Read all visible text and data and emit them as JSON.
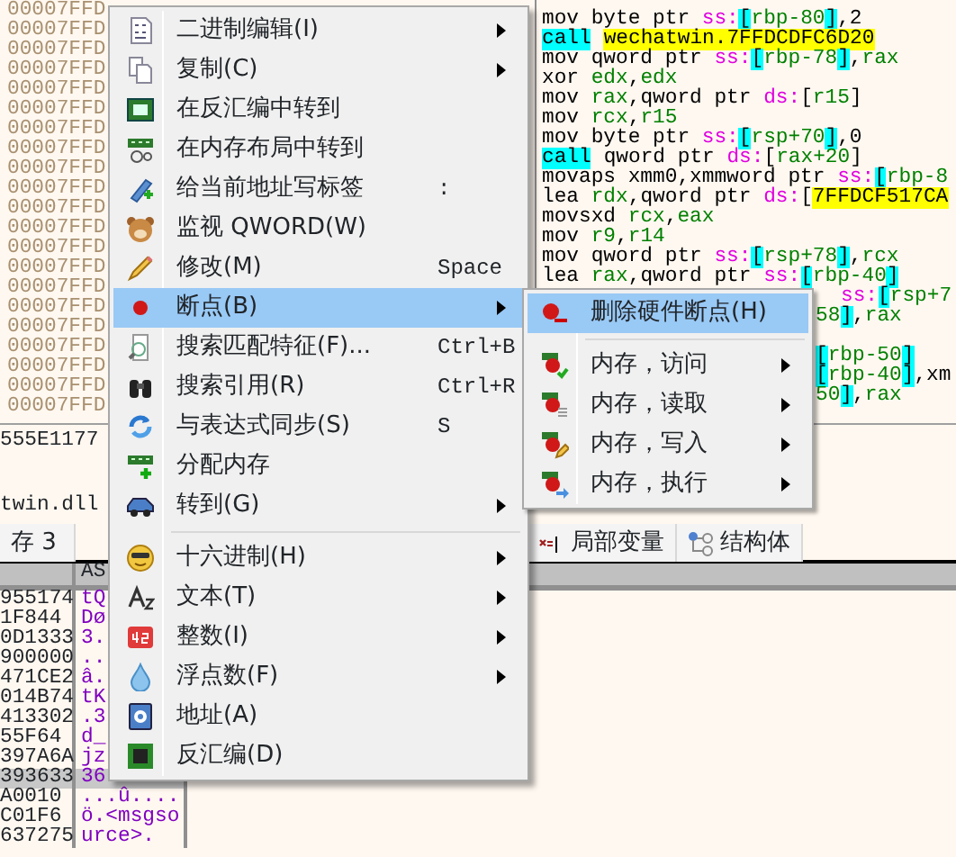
{
  "address_rows": [
    "00007FFD",
    "00007FFD",
    "00007FFD",
    "00007FFD",
    "00007FFD",
    "00007FFD",
    "00007FFD",
    "00007FFD",
    "00007FFD",
    "00007FFD",
    "00007FFD",
    "00007FFD",
    "00007FFD",
    "00007FFD",
    "00007FFD",
    "00007FFD",
    "00007FFD",
    "00007FFD",
    "00007FFD",
    "00007FFD",
    "00007FFD"
  ],
  "code_lines": [
    {
      "tokens": [
        {
          "kind": "plain",
          "text": "mov byte ptr "
        },
        {
          "kind": "segment",
          "text": "ss:"
        },
        {
          "kind": "bracket",
          "text": "["
        },
        {
          "kind": "register",
          "text": "rbp-80"
        },
        {
          "kind": "bracket",
          "text": "]"
        },
        {
          "kind": "plain",
          "text": ",2"
        }
      ]
    },
    {
      "tokens": [
        {
          "kind": "call",
          "text": "call"
        },
        {
          "kind": "address",
          "text": "wechatwin.7FFDCDFC6D20"
        }
      ]
    },
    {
      "tokens": [
        {
          "kind": "plain",
          "text": "mov qword ptr "
        },
        {
          "kind": "segment",
          "text": "ss:"
        },
        {
          "kind": "bracket",
          "text": "["
        },
        {
          "kind": "register",
          "text": "rbp-78"
        },
        {
          "kind": "bracket",
          "text": "]"
        },
        {
          "kind": "plain",
          "text": ","
        },
        {
          "kind": "register",
          "text": "rax"
        }
      ]
    },
    {
      "tokens": [
        {
          "kind": "plain",
          "text": "xor "
        },
        {
          "kind": "register",
          "text": "edx"
        },
        {
          "kind": "plain",
          "text": ","
        },
        {
          "kind": "register",
          "text": "edx"
        }
      ]
    },
    {
      "tokens": [
        {
          "kind": "plain",
          "text": "mov "
        },
        {
          "kind": "register",
          "text": "rax"
        },
        {
          "kind": "plain",
          "text": ",qword ptr "
        },
        {
          "kind": "segment",
          "text": "ds:"
        },
        {
          "kind": "plain",
          "text": "["
        },
        {
          "kind": "register",
          "text": "r15"
        },
        {
          "kind": "plain",
          "text": "]"
        }
      ]
    },
    {
      "tokens": [
        {
          "kind": "plain",
          "text": "mov "
        },
        {
          "kind": "register",
          "text": "rcx"
        },
        {
          "kind": "plain",
          "text": ","
        },
        {
          "kind": "register",
          "text": "r15"
        }
      ]
    },
    {
      "tokens": [
        {
          "kind": "plain",
          "text": "mov byte ptr "
        },
        {
          "kind": "segment",
          "text": "ss:"
        },
        {
          "kind": "bracket",
          "text": "["
        },
        {
          "kind": "register",
          "text": "rsp+70"
        },
        {
          "kind": "bracket",
          "text": "]"
        },
        {
          "kind": "plain",
          "text": ",0"
        }
      ]
    },
    {
      "tokens": [
        {
          "kind": "call",
          "text": "call"
        },
        {
          "kind": "plain",
          "text": "qword ptr "
        },
        {
          "kind": "segment",
          "text": "ds:"
        },
        {
          "kind": "plain",
          "text": "["
        },
        {
          "kind": "register",
          "text": "rax+20"
        },
        {
          "kind": "plain",
          "text": "]"
        }
      ]
    },
    {
      "tokens": [
        {
          "kind": "plain",
          "text": "movaps xmm0,xmmword ptr "
        },
        {
          "kind": "segment",
          "text": "ss:"
        },
        {
          "kind": "bracket",
          "text": "["
        },
        {
          "kind": "register",
          "text": "rbp-8"
        }
      ]
    },
    {
      "tokens": [
        {
          "kind": "plain",
          "text": "lea "
        },
        {
          "kind": "register",
          "text": "rdx"
        },
        {
          "kind": "plain",
          "text": ",qword ptr "
        },
        {
          "kind": "segment",
          "text": "ds:"
        },
        {
          "kind": "plain",
          "text": "["
        },
        {
          "kind": "address",
          "text": "7FFDCF517CA"
        }
      ]
    },
    {
      "tokens": [
        {
          "kind": "plain",
          "text": "movsxd "
        },
        {
          "kind": "register",
          "text": "rcx"
        },
        {
          "kind": "plain",
          "text": ","
        },
        {
          "kind": "register",
          "text": "eax"
        }
      ]
    },
    {
      "tokens": [
        {
          "kind": "plain",
          "text": "mov "
        },
        {
          "kind": "register",
          "text": "r9"
        },
        {
          "kind": "plain",
          "text": ","
        },
        {
          "kind": "register",
          "text": "r14"
        }
      ]
    },
    {
      "tokens": [
        {
          "kind": "plain",
          "text": "mov qword ptr "
        },
        {
          "kind": "segment",
          "text": "ss:"
        },
        {
          "kind": "bracket",
          "text": "["
        },
        {
          "kind": "register",
          "text": "rsp+78"
        },
        {
          "kind": "bracket",
          "text": "]"
        },
        {
          "kind": "plain",
          "text": ","
        },
        {
          "kind": "register",
          "text": "rcx"
        }
      ]
    },
    {
      "tokens": [
        {
          "kind": "plain",
          "text": "lea "
        },
        {
          "kind": "register",
          "text": "rax"
        },
        {
          "kind": "plain",
          "text": ",qword ptr "
        },
        {
          "kind": "segment",
          "text": "ss:"
        },
        {
          "kind": "bracket",
          "text": "["
        },
        {
          "kind": "register",
          "text": "rbp-40"
        },
        {
          "kind": "bracket",
          "text": "]"
        }
      ]
    },
    {
      "fragment": [
        {
          "kind": "segment",
          "text": "ss:"
        },
        {
          "kind": "bracket",
          "text": "["
        },
        {
          "kind": "register",
          "text": "rsp+7"
        }
      ]
    },
    {
      "fragment": [
        {
          "kind": "register",
          "text": "58"
        },
        {
          "kind": "bracket",
          "text": "]"
        },
        {
          "kind": "plain",
          "text": ","
        },
        {
          "kind": "register",
          "text": "rax"
        }
      ]
    },
    {
      "fragment": [
        {
          "kind": "bracket",
          "text": "["
        },
        {
          "kind": "register",
          "text": "rbp-50"
        },
        {
          "kind": "bracket",
          "text": "]"
        }
      ]
    },
    {
      "fragment": [
        {
          "kind": "bracket",
          "text": "["
        },
        {
          "kind": "register",
          "text": "rbp-40"
        },
        {
          "kind": "bracket",
          "text": "]"
        },
        {
          "kind": "plain",
          "text": ",xm"
        }
      ]
    },
    {
      "fragment": [
        {
          "kind": "register",
          "text": "50"
        },
        {
          "kind": "bracket",
          "text": "]"
        },
        {
          "kind": "plain",
          "text": ","
        },
        {
          "kind": "register",
          "text": "rax"
        }
      ]
    }
  ],
  "lower_left": {
    "address": "555E1177",
    "module": "twin.dll"
  },
  "tabs": [
    {
      "label": "存 3",
      "kind": "text"
    },
    {
      "label": "局部变量",
      "kind": "locals"
    },
    {
      "label": "结构体",
      "kind": "struct"
    }
  ],
  "dump": {
    "column_2": "AS",
    "rows": [
      {
        "hex": "955174",
        "ascii": "tQ",
        "selected": false
      },
      {
        "hex": "1F844",
        "ascii": "Dø",
        "selected": false
      },
      {
        "hex": "0D1333",
        "ascii": "3.",
        "selected": false
      },
      {
        "hex": "900000",
        "ascii": "..",
        "selected": false
      },
      {
        "hex": "471CE2",
        "ascii": "â.",
        "selected": false
      },
      {
        "hex": "014B74",
        "ascii": "tK",
        "selected": false
      },
      {
        "hex": "413302",
        "ascii": ".3",
        "selected": false
      },
      {
        "hex": "55F64",
        "ascii": "d_",
        "selected": false
      },
      {
        "hex": "397A6A",
        "ascii": "jz",
        "selected": false
      },
      {
        "hex": "393633",
        "ascii": "36",
        "selected": true
      },
      {
        "hex": "A0010",
        "ascii": "...û....",
        "selected": false
      },
      {
        "hex": "C01F6",
        "ascii": "ö.<msgso",
        "selected": false
      },
      {
        "hex": "637275",
        "ascii": "urce>.",
        "selected": false
      }
    ]
  },
  "context_menu": [
    {
      "label": "二进制编辑(I)",
      "submenu": true,
      "selected": false
    },
    {
      "label": "复制(C)",
      "submenu": true,
      "selected": false
    },
    {
      "label": "在反汇编中转到",
      "submenu": false,
      "selected": false
    },
    {
      "label": "在内存布局中转到",
      "submenu": false,
      "selected": false
    },
    {
      "label": "给当前地址写标签",
      "shortcut": ":",
      "submenu": false,
      "selected": false
    },
    {
      "label": "监视 QWORD(W)",
      "submenu": false,
      "selected": false
    },
    {
      "label": "修改(M)",
      "shortcut": "Space",
      "submenu": false,
      "selected": false
    },
    {
      "label": "断点(B)",
      "submenu": true,
      "selected": true
    },
    {
      "label": "搜索匹配特征(F)...",
      "shortcut": "Ctrl+B",
      "submenu": false,
      "selected": false
    },
    {
      "label": "搜索引用(R)",
      "shortcut": "Ctrl+R",
      "submenu": false,
      "selected": false
    },
    {
      "label": "与表达式同步(S)",
      "shortcut": "S",
      "submenu": false,
      "selected": false
    },
    {
      "label": "分配内存",
      "submenu": false,
      "selected": false
    },
    {
      "label": "转到(G)",
      "submenu": true,
      "selected": false
    },
    {
      "label": "十六进制(H)",
      "submenu": true,
      "selected": false,
      "separator_before": true
    },
    {
      "label": "文本(T)",
      "submenu": true,
      "selected": false
    },
    {
      "label": "整数(I)",
      "submenu": true,
      "selected": false
    },
    {
      "label": "浮点数(F)",
      "submenu": true,
      "selected": false
    },
    {
      "label": "地址(A)",
      "submenu": false,
      "selected": false
    },
    {
      "label": "反汇编(D)",
      "submenu": false,
      "selected": false
    }
  ],
  "breakpoint_submenu": [
    {
      "label": "删除硬件断点(H)",
      "submenu": false,
      "selected": true
    },
    {
      "label": "内存，访问",
      "submenu": true,
      "selected": false,
      "separator_before": true
    },
    {
      "label": "内存，读取",
      "submenu": true,
      "selected": false
    },
    {
      "label": "内存，写入",
      "submenu": true,
      "selected": false
    },
    {
      "label": "内存，执行",
      "submenu": true,
      "selected": false
    }
  ]
}
